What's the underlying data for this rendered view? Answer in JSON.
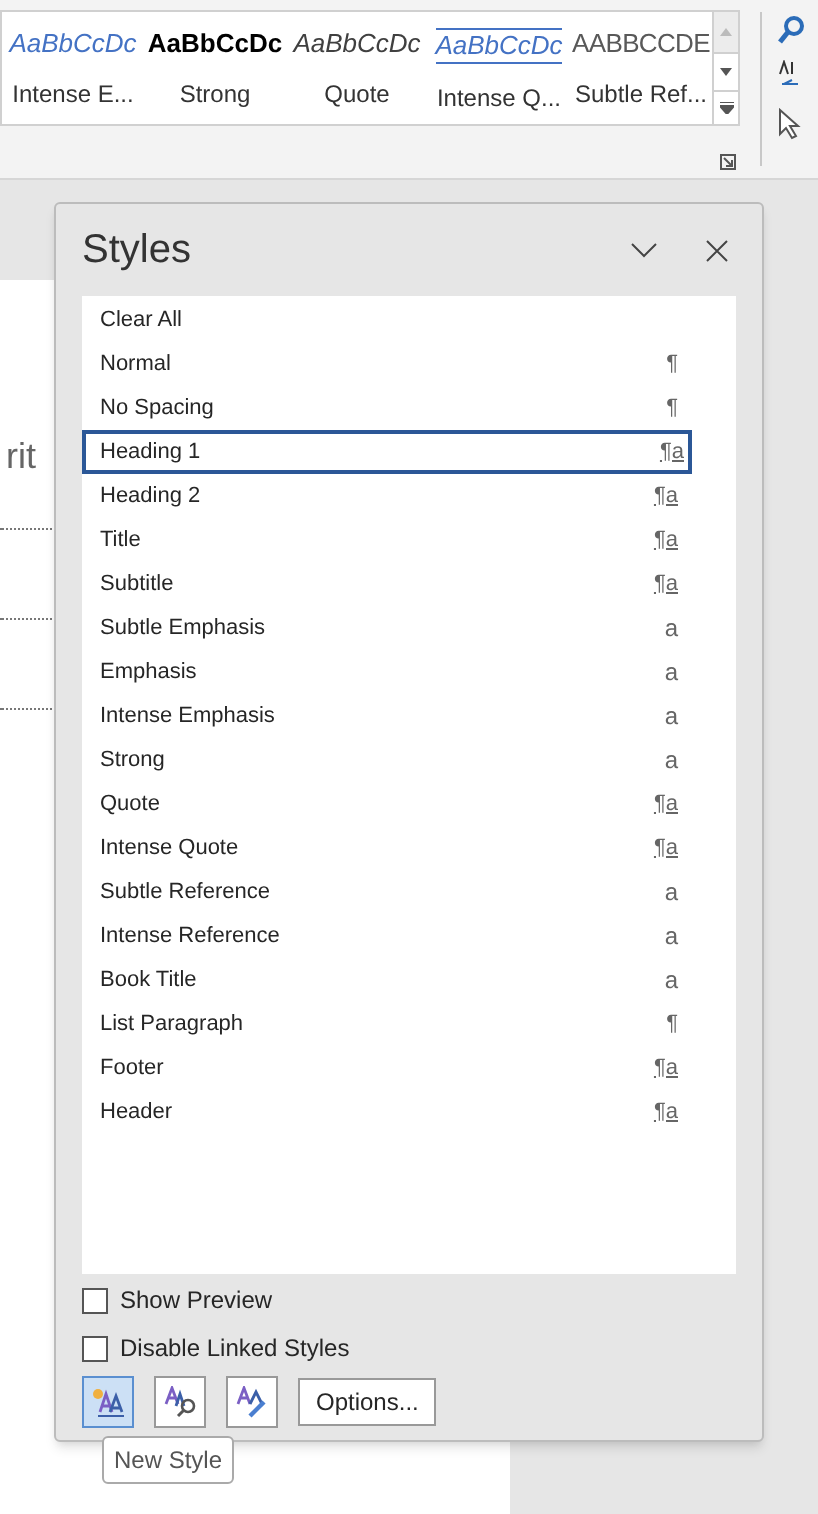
{
  "gallery": [
    {
      "preview": "AaBbCcDc",
      "label": "Intense E...",
      "kind": "intense-emphasis",
      "selected": false
    },
    {
      "preview": "AaBbCcDc",
      "label": "Strong",
      "kind": "strong",
      "selected": false
    },
    {
      "preview": "AaBbCcDc",
      "label": "Quote",
      "kind": "quote",
      "selected": false
    },
    {
      "preview": "AaBbCcDc",
      "label": "Intense Q...",
      "kind": "intense-quote",
      "selected": false
    },
    {
      "preview": "AABBCCDE",
      "label": "Subtle Ref...",
      "kind": "subtle-reference",
      "selected": false
    }
  ],
  "document": {
    "text": "rit"
  },
  "styles_pane": {
    "title": "Styles",
    "items": [
      {
        "name": "Clear All",
        "selected": false
      },
      {
        "name": "Normal",
        "symbol": "¶",
        "kind": "paragraph",
        "selected": false
      },
      {
        "name": "No Spacing",
        "symbol": "¶",
        "kind": "paragraph",
        "selected": false
      },
      {
        "name": "Heading 1",
        "symbol": "¶a",
        "kind": "linked",
        "selected": true
      },
      {
        "name": "Heading 2",
        "symbol": "¶a",
        "kind": "linked",
        "selected": false
      },
      {
        "name": "Title",
        "symbol": "¶a",
        "kind": "linked",
        "selected": false
      },
      {
        "name": "Subtitle",
        "symbol": "¶a",
        "kind": "linked",
        "selected": false
      },
      {
        "name": "Subtle Emphasis",
        "symbol": "a",
        "kind": "character",
        "selected": false
      },
      {
        "name": "Emphasis",
        "symbol": "a",
        "kind": "character",
        "selected": false
      },
      {
        "name": "Intense Emphasis",
        "symbol": "a",
        "kind": "character",
        "selected": false
      },
      {
        "name": "Strong",
        "symbol": "a",
        "kind": "character",
        "selected": false
      },
      {
        "name": "Quote",
        "symbol": "¶a",
        "kind": "linked",
        "selected": false
      },
      {
        "name": "Intense Quote",
        "symbol": "¶a",
        "kind": "linked",
        "selected": false
      },
      {
        "name": "Subtle Reference",
        "symbol": "a",
        "kind": "character",
        "selected": false
      },
      {
        "name": "Intense Reference",
        "symbol": "a",
        "kind": "character",
        "selected": false
      },
      {
        "name": "Book Title",
        "symbol": "a",
        "kind": "character",
        "selected": false
      },
      {
        "name": "List Paragraph",
        "symbol": "¶",
        "kind": "paragraph",
        "selected": false
      },
      {
        "name": "Footer",
        "symbol": "¶a",
        "kind": "linked",
        "selected": false
      },
      {
        "name": "Header",
        "symbol": "¶a",
        "kind": "linked",
        "selected": false
      }
    ],
    "checkboxes": [
      {
        "label": "Show Preview",
        "checked": false
      },
      {
        "label": "Disable Linked Styles",
        "checked": false
      }
    ],
    "tool_buttons": [
      {
        "kind": "new",
        "selected": true
      },
      {
        "kind": "inspect",
        "selected": false
      },
      {
        "kind": "manage",
        "selected": false
      }
    ],
    "options_button": "Options...",
    "tooltip": "New Style"
  }
}
